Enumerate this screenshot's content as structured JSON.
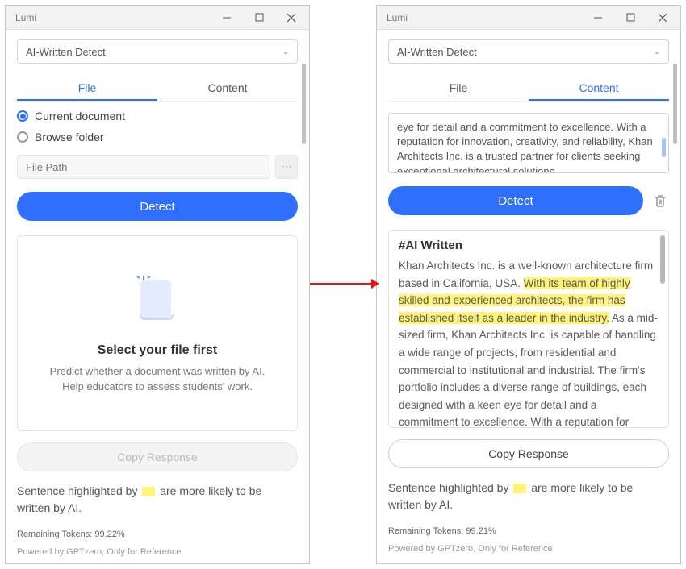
{
  "app_title": "Lumi",
  "dropdown": {
    "label": "AI-Written Detect"
  },
  "tabs": {
    "file": "File",
    "content": "Content"
  },
  "radio": {
    "current": "Current document",
    "browse": "Browse folder"
  },
  "filepath_placeholder": "File Path",
  "detect_label": "Detect",
  "placeholder": {
    "heading": "Select your file first",
    "body": "Predict whether a document was written by AI. Help educators to assess students' work."
  },
  "copy_response": "Copy Response",
  "legend_a": "Sentence highlighted by ",
  "legend_b": " are more likely to be written by AI.",
  "tokens_left": "Remaining Tokens: 99.22%",
  "tokens_right": "Remaining Tokens: 99.21%",
  "powered": "Powered by GPTzero, Only for Reference",
  "content_preview": "eye for detail and a commitment to excellence. With a reputation for innovation, creativity, and reliability, Khan Architects Inc. is a trusted partner for clients seeking exceptional architectural solutions.",
  "result": {
    "heading": "#AI Written",
    "pre": "Khan Architects Inc. is a well-known architecture firm based in California, USA. ",
    "highlight": "With its team of highly skilled and experienced architects, the firm has established itself as a leader in the industry.",
    "post": " As a mid-sized firm, Khan Architects Inc. is capable of handling a wide range of projects, from residential and commercial to institutional and industrial. The firm's portfolio includes a diverse range of buildings, each designed with a keen eye for detail and a commitment to excellence. With a reputation for innovation, creativity, and reliability, Khan Architects "
  }
}
